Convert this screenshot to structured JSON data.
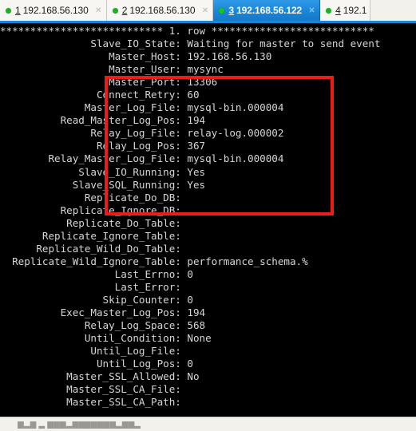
{
  "tabs": [
    {
      "number": "1",
      "label": "192.168.56.130",
      "status_icon": "green-dot-icon",
      "close_icon": "close-icon",
      "active": false
    },
    {
      "number": "2",
      "label": "192.168.56.130",
      "status_icon": "green-dot-icon",
      "close_icon": "close-icon",
      "active": false
    },
    {
      "number": "3",
      "label": "192.168.56.122",
      "status_icon": "green-dot-icon",
      "close_icon": "close-icon",
      "active": true
    },
    {
      "number": "4",
      "label": "192.1",
      "status_icon": "green-dot-icon",
      "close_icon": "close-icon",
      "active": false
    }
  ],
  "terminal": {
    "row_header": "*************************** 1. row ***************************",
    "fields": [
      {
        "key": "Slave_IO_State",
        "value": "Waiting for master to send event"
      },
      {
        "key": "Master_Host",
        "value": "192.168.56.130"
      },
      {
        "key": "Master_User",
        "value": "mysync"
      },
      {
        "key": "Master_Port",
        "value": "13306"
      },
      {
        "key": "Connect_Retry",
        "value": "60"
      },
      {
        "key": "Master_Log_File",
        "value": "mysql-bin.000004"
      },
      {
        "key": "Read_Master_Log_Pos",
        "value": "194"
      },
      {
        "key": "Relay_Log_File",
        "value": "relay-log.000002"
      },
      {
        "key": "Relay_Log_Pos",
        "value": "367"
      },
      {
        "key": "Relay_Master_Log_File",
        "value": "mysql-bin.000004"
      },
      {
        "key": "Slave_IO_Running",
        "value": "Yes"
      },
      {
        "key": "Slave_SQL_Running",
        "value": "Yes"
      },
      {
        "key": "Replicate_Do_DB",
        "value": ""
      },
      {
        "key": "Replicate_Ignore_DB",
        "value": ""
      },
      {
        "key": "Replicate_Do_Table",
        "value": ""
      },
      {
        "key": "Replicate_Ignore_Table",
        "value": ""
      },
      {
        "key": "Replicate_Wild_Do_Table",
        "value": ""
      },
      {
        "key": "Replicate_Wild_Ignore_Table",
        "value": "performance_schema.%"
      },
      {
        "key": "Last_Errno",
        "value": "0"
      },
      {
        "key": "Last_Error",
        "value": ""
      },
      {
        "key": "Skip_Counter",
        "value": "0"
      },
      {
        "key": "Exec_Master_Log_Pos",
        "value": "194"
      },
      {
        "key": "Relay_Log_Space",
        "value": "568"
      },
      {
        "key": "Until_Condition",
        "value": "None"
      },
      {
        "key": "Until_Log_File",
        "value": ""
      },
      {
        "key": "Until_Log_Pos",
        "value": "0"
      },
      {
        "key": "Master_SSL_Allowed",
        "value": "No"
      },
      {
        "key": "Master_SSL_CA_File",
        "value": ""
      },
      {
        "key": "Master_SSL_CA_Path",
        "value": ""
      }
    ]
  },
  "annotation": {
    "shape": "rectangle-highlight",
    "color": "#ee1c18",
    "covers_from": "Master_Host",
    "covers_to": "Slave_SQL_Running"
  },
  "bottom_bar": {
    "text": "█▄█ ▄ ███▄███████▄██▄"
  },
  "colors": {
    "tab_active_bg": "#1a86d8",
    "tab_inactive_bg": "#f7f6f2",
    "tab_bar_bg": "#f2f1ec",
    "status_dot": "#18b21a",
    "terminal_bg": "#000000",
    "terminal_fg": "#d6d6d6",
    "annotation": "#ee1c18"
  }
}
